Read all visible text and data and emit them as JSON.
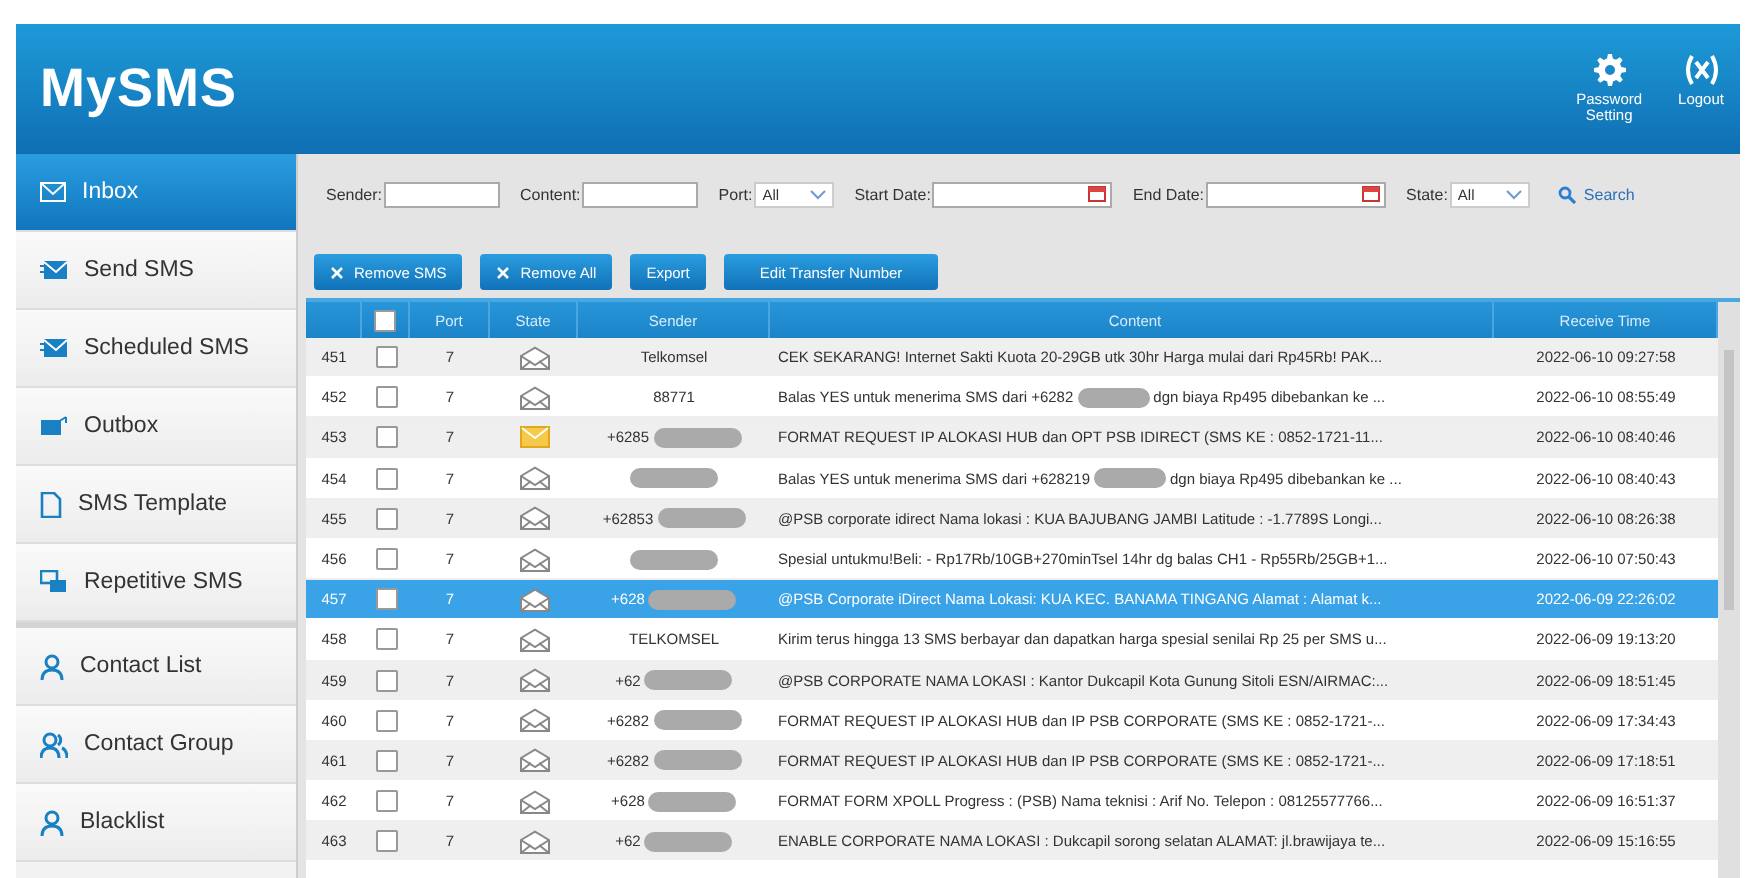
{
  "header": {
    "logo": "MySMS",
    "actions": [
      {
        "kind": "settings",
        "label": [
          "Password",
          "Setting"
        ]
      },
      {
        "kind": "logout",
        "label": [
          "Logout"
        ]
      }
    ]
  },
  "sidebar": {
    "items": [
      {
        "label": "Inbox",
        "kind": "inbox",
        "selected": true,
        "group_start": false
      },
      {
        "label": "Send SMS",
        "kind": "send",
        "selected": false,
        "group_start": false
      },
      {
        "label": "Scheduled SMS",
        "kind": "send",
        "selected": false,
        "group_start": false
      },
      {
        "label": "Outbox",
        "kind": "outbox",
        "selected": false,
        "group_start": false
      },
      {
        "label": "SMS Template",
        "kind": "template",
        "selected": false,
        "group_start": false
      },
      {
        "label": "Repetitive SMS",
        "kind": "repeat",
        "selected": false,
        "group_start": false
      },
      {
        "label": "Contact List",
        "kind": "person",
        "selected": false,
        "group_start": true
      },
      {
        "label": "Contact Group",
        "kind": "people",
        "selected": false,
        "group_start": false
      },
      {
        "label": "Blacklist",
        "kind": "person",
        "selected": false,
        "group_start": false
      }
    ]
  },
  "filters": {
    "sender_label": "Sender:",
    "content_label": "Content:",
    "port_label": "Port:",
    "port_value": "All",
    "start_label": "Start Date:",
    "end_label": "End Date:",
    "state_label": "State:",
    "state_value": "All",
    "search": "Search"
  },
  "buttons": [
    {
      "label": "Remove SMS",
      "kind": "remove"
    },
    {
      "label": "Remove All",
      "kind": "remove"
    },
    {
      "label": "Export",
      "kind": "plain"
    },
    {
      "label": "Edit Transfer Number",
      "kind": "plain"
    }
  ],
  "table": {
    "columns": [
      "Port",
      "State",
      "Sender",
      "Content",
      "Receive Time"
    ],
    "header_checked": false,
    "rows": [
      {
        "no": "451",
        "checked": false,
        "port": "7",
        "unread": false,
        "sender": "Telkomsel",
        "sender_redacted": false,
        "content": [
          "CEK SEKARANG! Internet Sakti Kuota 20-29GB utk 30hr Harga mulai dari Rp45Rb! PAK..."
        ],
        "time": "2022-06-10 09:27:58",
        "selected": false
      },
      {
        "no": "452",
        "checked": false,
        "port": "7",
        "unread": false,
        "sender": "88771",
        "sender_redacted": false,
        "content": [
          "Balas YES untuk menerima SMS dari +6282",
          "dgn biaya Rp495 dibebankan ke ..."
        ],
        "time": "2022-06-10 08:55:49",
        "selected": false
      },
      {
        "no": "453",
        "checked": false,
        "port": "7",
        "unread": true,
        "sender": "+6285",
        "sender_redacted": true,
        "content": [
          "FORMAT REQUEST IP ALOKASI HUB dan OPT PSB IDIRECT (SMS KE : 0852-1721-11..."
        ],
        "time": "2022-06-10 08:40:46",
        "selected": false
      },
      {
        "no": "454",
        "checked": false,
        "port": "7",
        "unread": false,
        "sender": "",
        "sender_redacted": true,
        "content": [
          "Balas YES untuk menerima SMS dari +628219",
          "dgn biaya Rp495 dibebankan ke ..."
        ],
        "time": "2022-06-10 08:40:43",
        "selected": false
      },
      {
        "no": "455",
        "checked": false,
        "port": "7",
        "unread": false,
        "sender": "+62853",
        "sender_redacted": true,
        "content": [
          "@PSB corporate idirect Nama lokasi :  KUA BAJUBANG JAMBI Latitude : -1.7789S Longi..."
        ],
        "time": "2022-06-10 08:26:38",
        "selected": false
      },
      {
        "no": "456",
        "checked": false,
        "port": "7",
        "unread": false,
        "sender": "",
        "sender_redacted": true,
        "content": [
          "Spesial untukmu!Beli: - Rp17Rb/10GB+270minTsel 14hr dg balas CH1 - Rp55Rb/25GB+1..."
        ],
        "time": "2022-06-10 07:50:43",
        "selected": false
      },
      {
        "no": "457",
        "checked": false,
        "port": "7",
        "unread": false,
        "sender": "+628",
        "sender_redacted": true,
        "content": [
          "@PSB Corporate iDirect Nama Lokasi: KUA KEC. BANAMA TINGANG Alamat : Alamat k..."
        ],
        "time": "2022-06-09 22:26:02",
        "selected": true
      },
      {
        "no": "458",
        "checked": false,
        "port": "7",
        "unread": false,
        "sender": "TELKOMSEL",
        "sender_redacted": false,
        "content": [
          "Kirim terus hingga 13 SMS berbayar dan dapatkan harga spesial senilai Rp 25 per SMS u..."
        ],
        "time": "2022-06-09 19:13:20",
        "selected": false
      },
      {
        "no": "459",
        "checked": false,
        "port": "7",
        "unread": false,
        "sender": "+62",
        "sender_redacted": true,
        "content": [
          "@PSB CORPORATE NAMA LOKASI : Kantor Dukcapil Kota Gunung Sitoli ESN/AIRMAC:..."
        ],
        "time": "2022-06-09 18:51:45",
        "selected": false
      },
      {
        "no": "460",
        "checked": false,
        "port": "7",
        "unread": false,
        "sender": "+6282",
        "sender_redacted": true,
        "content": [
          "FORMAT REQUEST IP ALOKASI HUB dan IP PSB CORPORATE (SMS KE : 0852-1721-..."
        ],
        "time": "2022-06-09 17:34:43",
        "selected": false
      },
      {
        "no": "461",
        "checked": false,
        "port": "7",
        "unread": false,
        "sender": "+6282",
        "sender_redacted": true,
        "content": [
          "FORMAT REQUEST IP ALOKASI HUB dan IP PSB CORPORATE (SMS KE : 0852-1721-..."
        ],
        "time": "2022-06-09 17:18:51",
        "selected": false
      },
      {
        "no": "462",
        "checked": false,
        "port": "7",
        "unread": false,
        "sender": "+628",
        "sender_redacted": true,
        "content": [
          "FORMAT FORM XPOLL Progress : (PSB) Nama teknisi : Arif No. Telepon : 08125577766..."
        ],
        "time": "2022-06-09 16:51:37",
        "selected": false
      },
      {
        "no": "463",
        "checked": false,
        "port": "7",
        "unread": false,
        "sender": "+62",
        "sender_redacted": true,
        "content": [
          "ENABLE CORPORATE NAMA LOKASI : Dukcapil sorong selatan ALAMAT: jl.brawijaya te..."
        ],
        "time": "2022-06-09 15:16:55",
        "selected": false
      }
    ]
  }
}
